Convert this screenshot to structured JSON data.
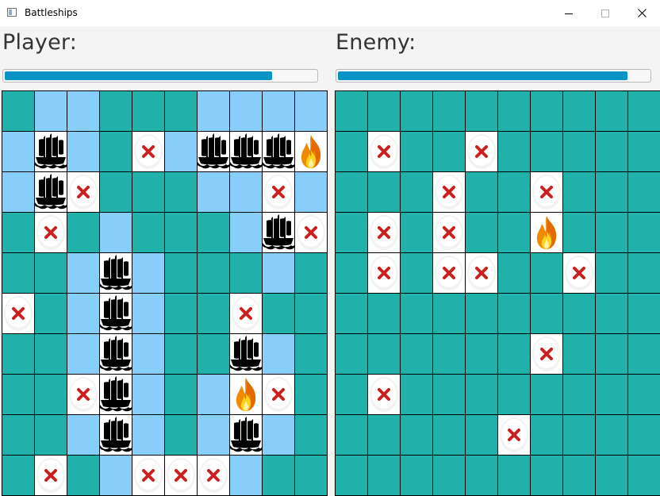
{
  "window": {
    "title": "Battleships"
  },
  "player": {
    "label": "Player:",
    "progress": 0.86,
    "grid": [
      "SEESSSEEEE",
      "EBESXEBBBF",
      "EBXSSSEEXE",
      "SXSESSSEBX",
      "SSEBESSSES",
      "XSEBESSXSS",
      "SSEBESSBES",
      "SSXBESEFXS",
      "SSEBESEBES",
      "SXSEXXXESS"
    ]
  },
  "enemy": {
    "label": "Enemy:",
    "progress": 0.93,
    "grid": [
      "SSSSSSSSSS",
      "SXSSXSSSSS",
      "SSSXSSXSSS",
      "SXSXSSFSSS",
      "SXSXXSSXSS",
      "SSSSSSSSSS",
      "SSSSSSXSSS",
      "SXSSSSSSSS",
      "SSSSSXSSSS",
      "SSSSSSSSSS"
    ]
  },
  "legend": {
    "S": "sea",
    "E": "empty",
    "X": "miss",
    "B": "ship",
    "F": "hit"
  },
  "icons": {
    "miss": "miss-x-icon",
    "ship": "ship-icon",
    "hit": "fire-icon"
  },
  "colors": {
    "sea": "#20b2aa",
    "empty": "#87cefa",
    "progress": "#0a93c5",
    "miss_x": "#cc1f1f"
  }
}
